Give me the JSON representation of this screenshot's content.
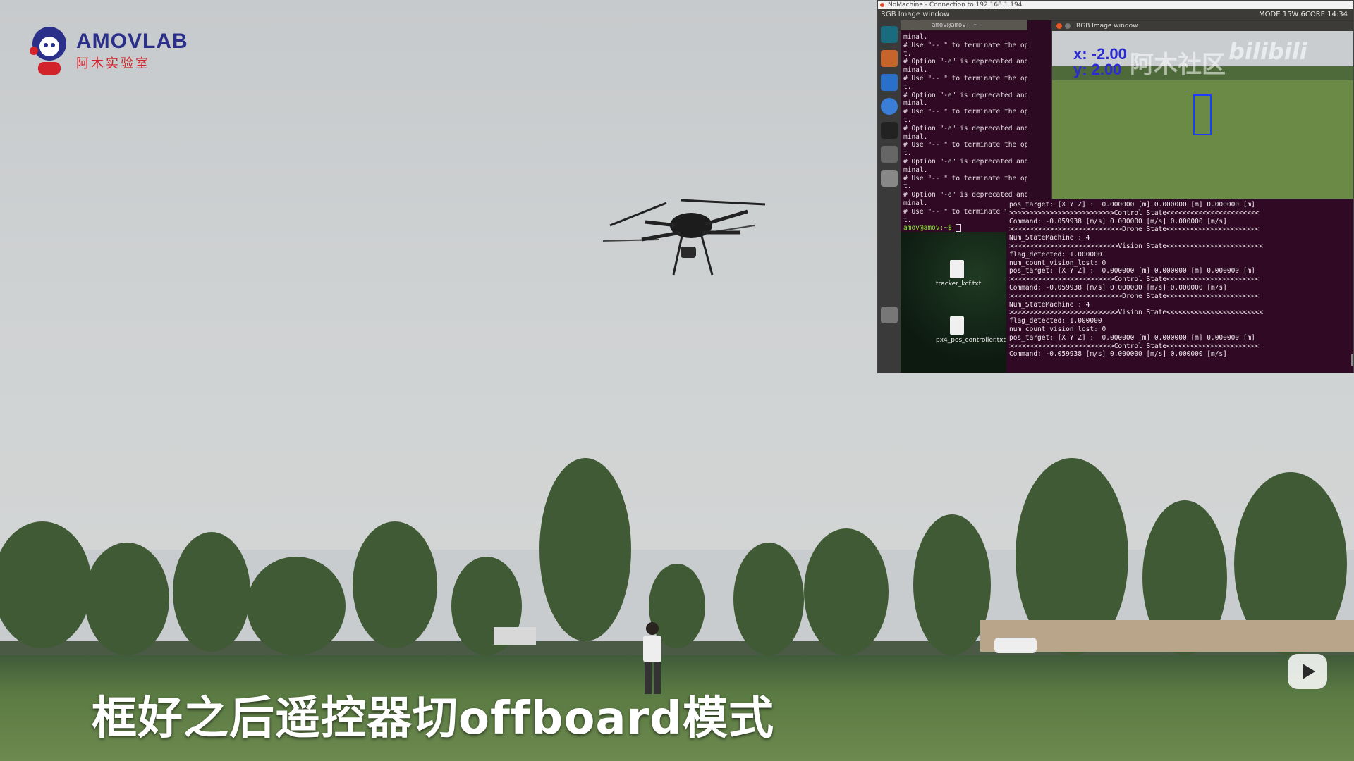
{
  "logo": {
    "name": "AMOVLAB",
    "sub": "阿木实验室",
    "colors": {
      "primary": "#2a2f8a",
      "accent": "#d3232a"
    }
  },
  "subtitle": "框好之后遥控器切offboard模式",
  "remote_desktop": {
    "nomachine_title": "NoMachine - Connection to 192.168.1.194",
    "topbar_left": "RGB Image window",
    "topbar_right": "MODE 15W 6CORE  14:34",
    "term_left_header": "amov@amov: ~",
    "term_left_lines": [
      "minal.",
      "# Use \"-- \" to terminate the options and put the command line to execute after i",
      "t.",
      "# Option \"-e\" is deprecated and might be removed in a later version of gnome-ter",
      "minal.",
      "# Use \"-- \" to terminate the options and put the command line to execute after i",
      "t.",
      "# Option \"-e\" is deprecated and might be removed in a later version of gnome-ter",
      "minal.",
      "# Use \"-- \" to terminate the options and put the command line to execute after i",
      "t.",
      "# Option \"-e\" is deprecated and might be removed in a later version of gnome-ter",
      "minal.",
      "# Use \"-- \" to terminate the options and put the command line to execute after i",
      "t.",
      "# Option \"-e\" is deprecated and might be removed in a later version of gnome-ter",
      "minal.",
      "# Use \"-- \" to terminate the options and put the command line to execute after i",
      "t.",
      "# Option \"-e\" is deprecated and might be removed in a later version of gnome-ter",
      "minal.",
      "# Use \"-- \" to terminate the options and put the command line to execute after i",
      "t."
    ],
    "term_left_prompt": "amov@amov:~$ ",
    "desktop_files": [
      "tracker_kcf.txt",
      "px4_pos_controller.txt"
    ],
    "term_main_lines": [
      "pos_target: [X Y Z] :  0.000000 [m] 0.000000 [m] 0.000000 [m]",
      ">>>>>>>>>>>>>>>>>>>>>>>>>>Control State<<<<<<<<<<<<<<<<<<<<<<<",
      "Command: -0.059938 [m/s] 0.000000 [m/s] 0.000000 [m/s]",
      ">>>>>>>>>>>>>>>>>>>>>>>>>>>>Drone State<<<<<<<<<<<<<<<<<<<<<<<",
      "Num_StateMachine : 4",
      ">>>>>>>>>>>>>>>>>>>>>>>>>>>Vision State<<<<<<<<<<<<<<<<<<<<<<<<",
      "flag_detected: 1.000000",
      "num_count_vision_lost: 0",
      "pos_target: [X Y Z] :  0.000000 [m] 0.000000 [m] 0.000000 [m]",
      ">>>>>>>>>>>>>>>>>>>>>>>>>>Control State<<<<<<<<<<<<<<<<<<<<<<<",
      "Command: -0.059938 [m/s] 0.000000 [m/s] 0.000000 [m/s]",
      ">>>>>>>>>>>>>>>>>>>>>>>>>>>>Drone State<<<<<<<<<<<<<<<<<<<<<<<",
      "Num_StateMachine : 4",
      ">>>>>>>>>>>>>>>>>>>>>>>>>>>Vision State<<<<<<<<<<<<<<<<<<<<<<<<",
      "flag_detected: 1.000000",
      "num_count_vision_lost: 0",
      "pos_target: [X Y Z] :  0.000000 [m] 0.000000 [m] 0.000000 [m]",
      ">>>>>>>>>>>>>>>>>>>>>>>>>>Control State<<<<<<<<<<<<<<<<<<<<<<<",
      "Command: -0.059938 [m/s] 0.000000 [m/s] 0.000000 [m/s]"
    ],
    "rgb_window": {
      "title": "RGB Image window",
      "x_label": "x: -2.00",
      "y_label": "y: 2.00",
      "watermark_cn": "阿木社区",
      "watermark_bili": "bilibili"
    }
  }
}
